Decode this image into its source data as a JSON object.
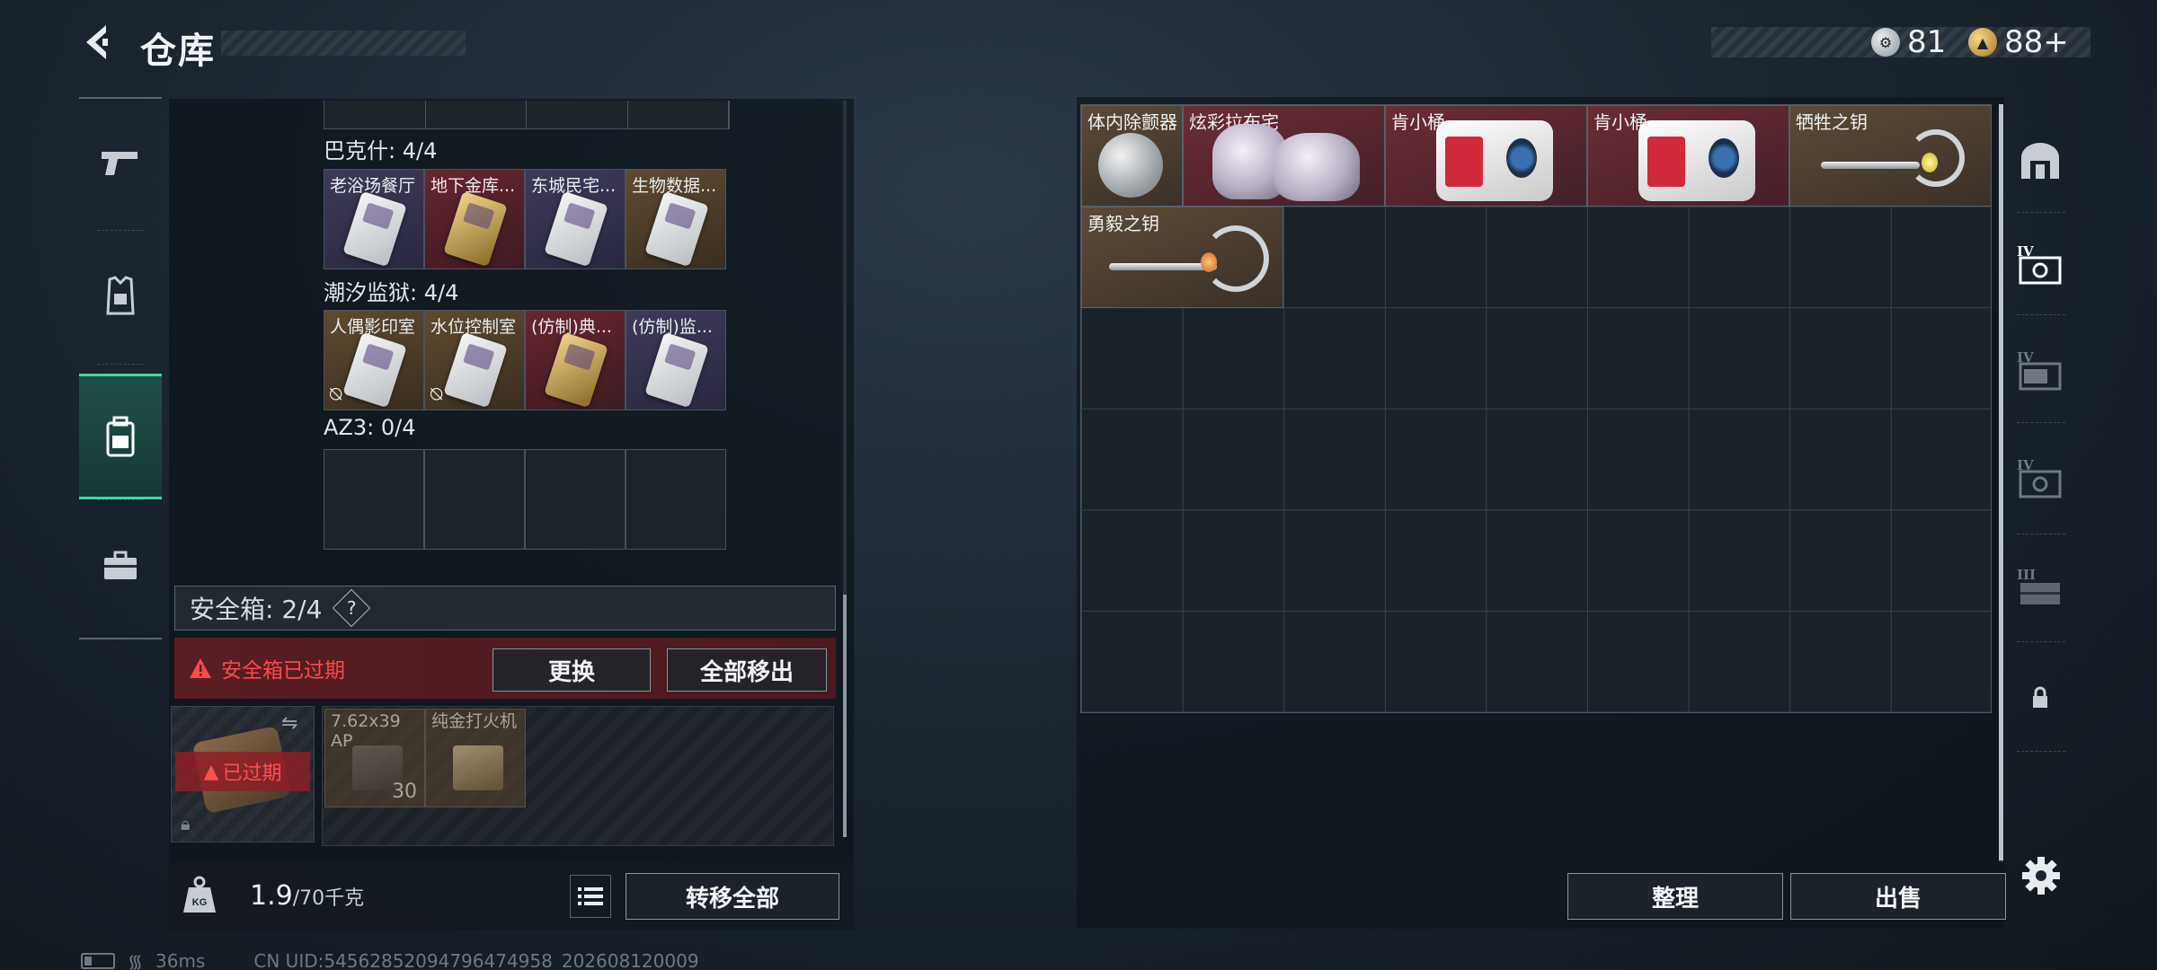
{
  "header": {
    "title": "仓库"
  },
  "currency": {
    "silver": "81",
    "gold": "88+"
  },
  "left_rail": [
    "weapons",
    "armor",
    "backpack",
    "case"
  ],
  "groups": [
    {
      "title": "巴克什: 4/4",
      "items": [
        {
          "label": "老浴场餐厅",
          "rarity": "purple"
        },
        {
          "label": "地下金库...",
          "rarity": "red"
        },
        {
          "label": "东城民宅...",
          "rarity": "purple"
        },
        {
          "label": "生物数据...",
          "rarity": "gold"
        }
      ]
    },
    {
      "title": "潮汐监狱: 4/4",
      "items": [
        {
          "label": "人偶影印室",
          "rarity": "gold"
        },
        {
          "label": "水位控制室",
          "rarity": "gold"
        },
        {
          "label": "(仿制)典...",
          "rarity": "red"
        },
        {
          "label": "(仿制)监...",
          "rarity": "purple"
        }
      ]
    },
    {
      "title": "AZ3: 0/4",
      "items": []
    }
  ],
  "safe_box": {
    "title": "安全箱: 2/4",
    "help": "?",
    "expired_message": "安全箱已过期",
    "replace_label": "更换",
    "remove_all_label": "全部移出",
    "case_status": "已过期",
    "items": [
      {
        "label": "7.62x39 AP",
        "count": "30"
      },
      {
        "label": "纯金打火机"
      }
    ]
  },
  "bottom_left": {
    "weight_current": "1.9",
    "weight_capacity": "/70千克",
    "transfer_all_label": "转移全部"
  },
  "status": {
    "ping": "36ms",
    "uid": "CN UID:54562852094796474958_202608120009"
  },
  "stash": {
    "items": [
      {
        "label": "体内除颤器",
        "rarity": "gold"
      },
      {
        "label": "炫彩拉布宅",
        "rarity": "red"
      },
      {
        "label": "肯小桶",
        "rarity": "red"
      },
      {
        "label": "肯小桶",
        "rarity": "red"
      },
      {
        "label": "牺牲之钥",
        "rarity": "gold"
      },
      {
        "label": "勇毅之钥",
        "rarity": "gold"
      }
    ],
    "sort_label": "整理",
    "sell_label": "出售"
  },
  "right_rail": [
    "IV",
    "IV",
    "IV",
    "III"
  ],
  "colors": {
    "accent": "#3bd9a3",
    "danger": "#ff4848",
    "red_rarity": "#6b2c35",
    "gold_rarity": "#5b4a38",
    "purple_rarity": "#3d3a58"
  }
}
